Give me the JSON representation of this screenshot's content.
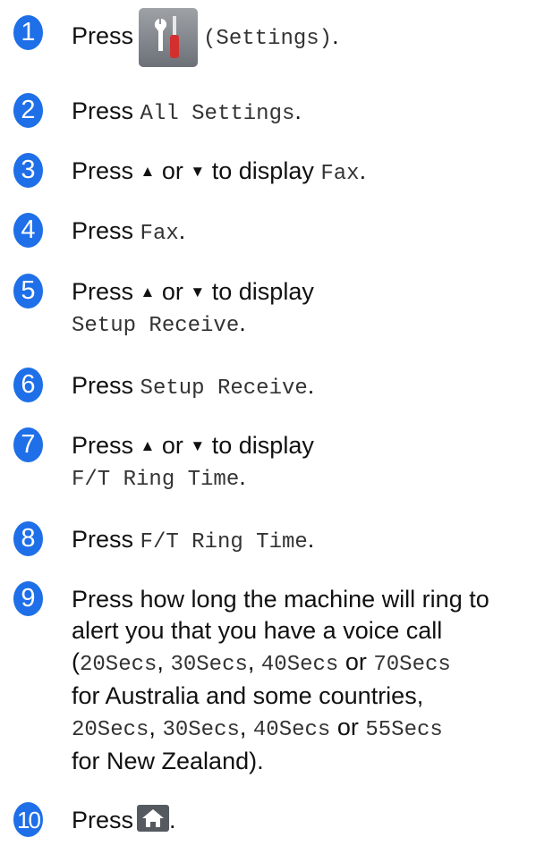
{
  "colors": {
    "badge": "#1e6fe8",
    "text": "#111111",
    "icon_bg": "#6c7178",
    "screwdriver": "#d32f2f"
  },
  "icons": {
    "settings": "settings-icon",
    "home": "home-icon"
  },
  "steps": [
    {
      "num": "1",
      "press": "Press",
      "label": "(Settings)",
      "end": "."
    },
    {
      "num": "2",
      "press": "Press",
      "item": "All Settings",
      "end": "."
    },
    {
      "num": "3",
      "press": "Press",
      "up": "▲",
      "or": "or",
      "down": "▼",
      "todisplay": "to display",
      "item": "Fax",
      "end": "."
    },
    {
      "num": "4",
      "press": "Press",
      "item": "Fax",
      "end": "."
    },
    {
      "num": "5",
      "press": "Press",
      "up": "▲",
      "or": "or",
      "down": "▼",
      "todisplay": "to display",
      "item": "Setup Receive",
      "end": "."
    },
    {
      "num": "6",
      "press": "Press",
      "item": "Setup Receive",
      "end": "."
    },
    {
      "num": "7",
      "press": "Press",
      "up": "▲",
      "or": "or",
      "down": "▼",
      "todisplay": "to display",
      "item": "F/T Ring Time",
      "end": "."
    },
    {
      "num": "8",
      "press": "Press",
      "item": "F/T Ring Time",
      "end": "."
    },
    {
      "num": "9",
      "line1": "Press how long the machine will ring to",
      "line2": "alert you that you have a voice call",
      "open": "(",
      "au_options": [
        "20Secs",
        "30Secs",
        "40Secs",
        "70Secs"
      ],
      "sep": ",",
      "or": "or",
      "au_tail": "for Australia and some countries,",
      "nz_options": [
        "20Secs",
        "30Secs",
        "40Secs",
        "55Secs"
      ],
      "nz_tail": "for New Zealand).",
      "close": ""
    },
    {
      "num": "10",
      "press": "Press",
      "end": "."
    }
  ]
}
